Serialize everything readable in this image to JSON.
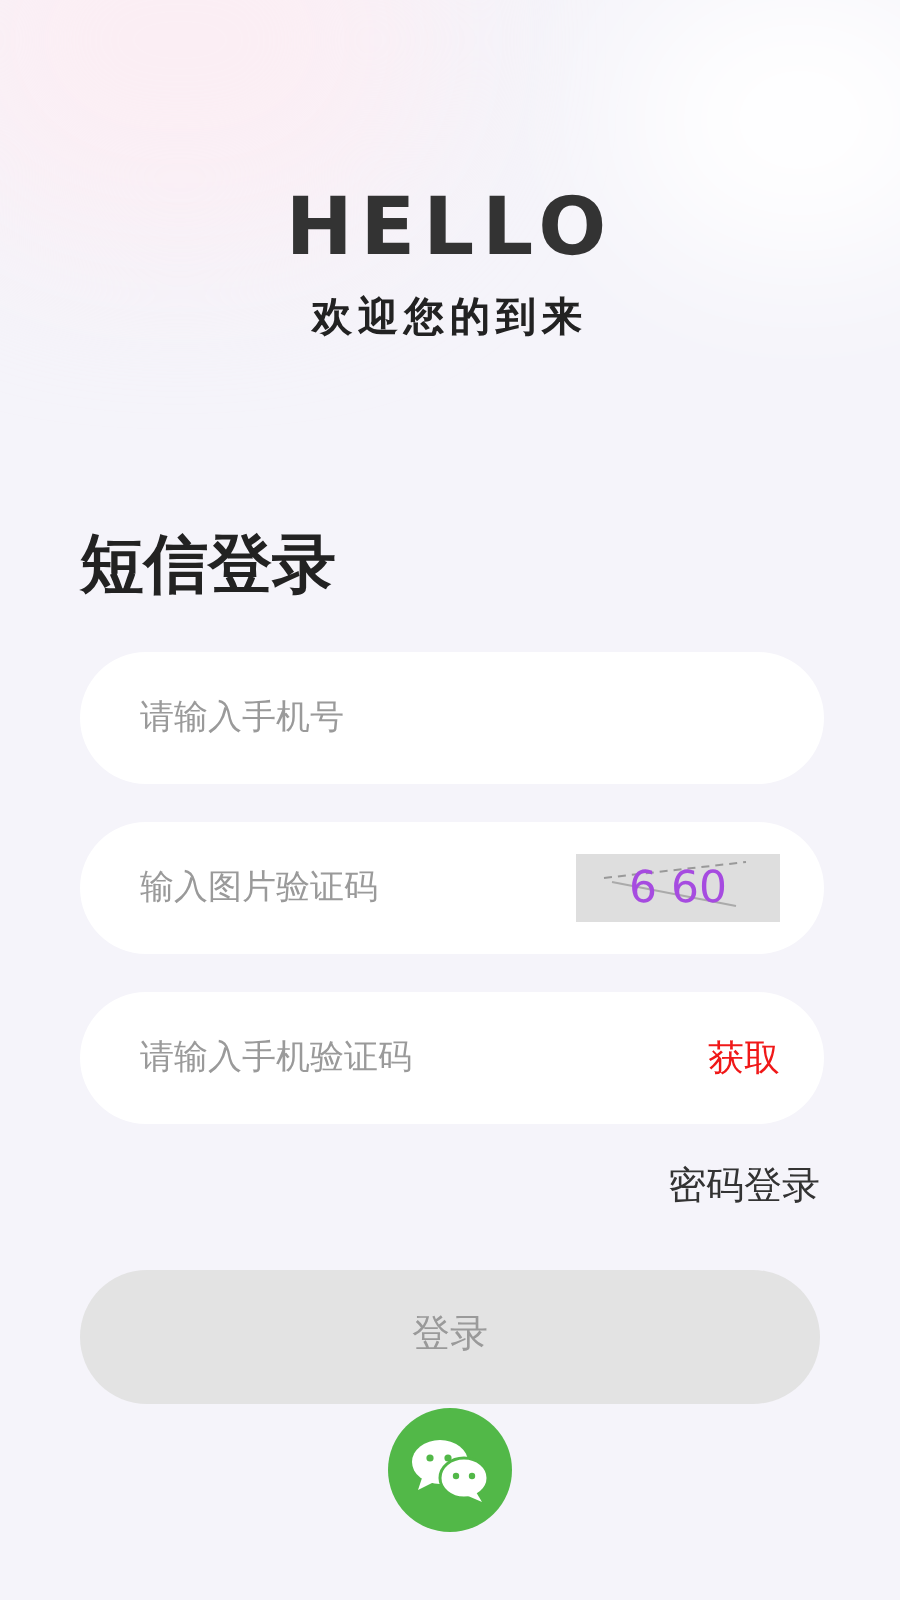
{
  "header": {
    "title": "HELLO",
    "subtitle": "欢迎您的到来"
  },
  "form_title": "短信登录",
  "fields": [
    {
      "kind": "plain",
      "placeholder": "请输入手机号"
    },
    {
      "kind": "captcha",
      "placeholder": "输入图片验证码",
      "captcha": "6 60"
    },
    {
      "kind": "code",
      "placeholder": "请输入手机验证码",
      "action": "获取"
    }
  ],
  "password_login_link": "密码登录",
  "login_button": {
    "label": "登录",
    "disabled": true
  }
}
